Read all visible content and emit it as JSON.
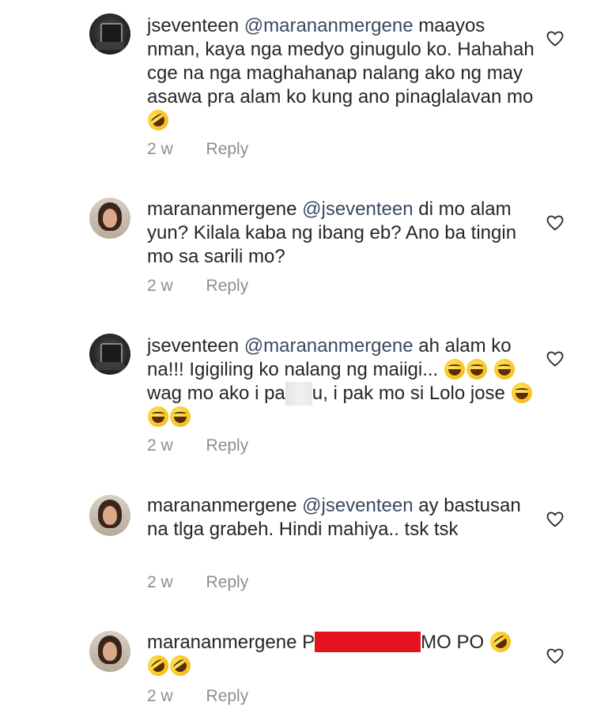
{
  "comments": [
    {
      "username": "jseventeen",
      "mention": "@marananmergene",
      "text": "maayos nman, kaya nga medyo ginugulo ko. Hahahah cge na nga maghahanap nalang ako ng may asawa pra alam ko kung ano pinaglalavan mo",
      "emoji": "rofl-emoji",
      "time": "2 w",
      "reply": "Reply"
    },
    {
      "username": "marananmergene",
      "mention": "@jseventeen",
      "text": "di mo alam yun? Kilala kaba ng ibang eb? Ano ba tingin mo sa sarili mo?",
      "time": "2 w",
      "reply": "Reply"
    },
    {
      "username": "jseventeen",
      "mention": "@marananmergene",
      "text_a": "ah alam ko na!!! Igigiling ko nalang ng maiigi...",
      "text_b": "wag mo ako i pa",
      "text_c": "u, i pak mo si Lolo jose",
      "time": "2 w",
      "reply": "Reply"
    },
    {
      "username": "marananmergene",
      "mention": "@jseventeen",
      "text": "ay bastusan na tlga grabeh. Hindi mahiya.. tsk tsk",
      "time": "2 w",
      "reply": "Reply"
    },
    {
      "username": "marananmergene",
      "text_a": "P",
      "text_b": "MO PO",
      "time": "2 w",
      "reply": "Reply"
    }
  ],
  "colors": {
    "text": "#262626",
    "mention": "#3a4a63",
    "meta": "#8e8e8e",
    "redaction": "#e4131d"
  },
  "icons": [
    "heart-outline-icon",
    "rofl-emoji",
    "grin-sweat-emoji",
    "tears-of-joy-emoji"
  ]
}
